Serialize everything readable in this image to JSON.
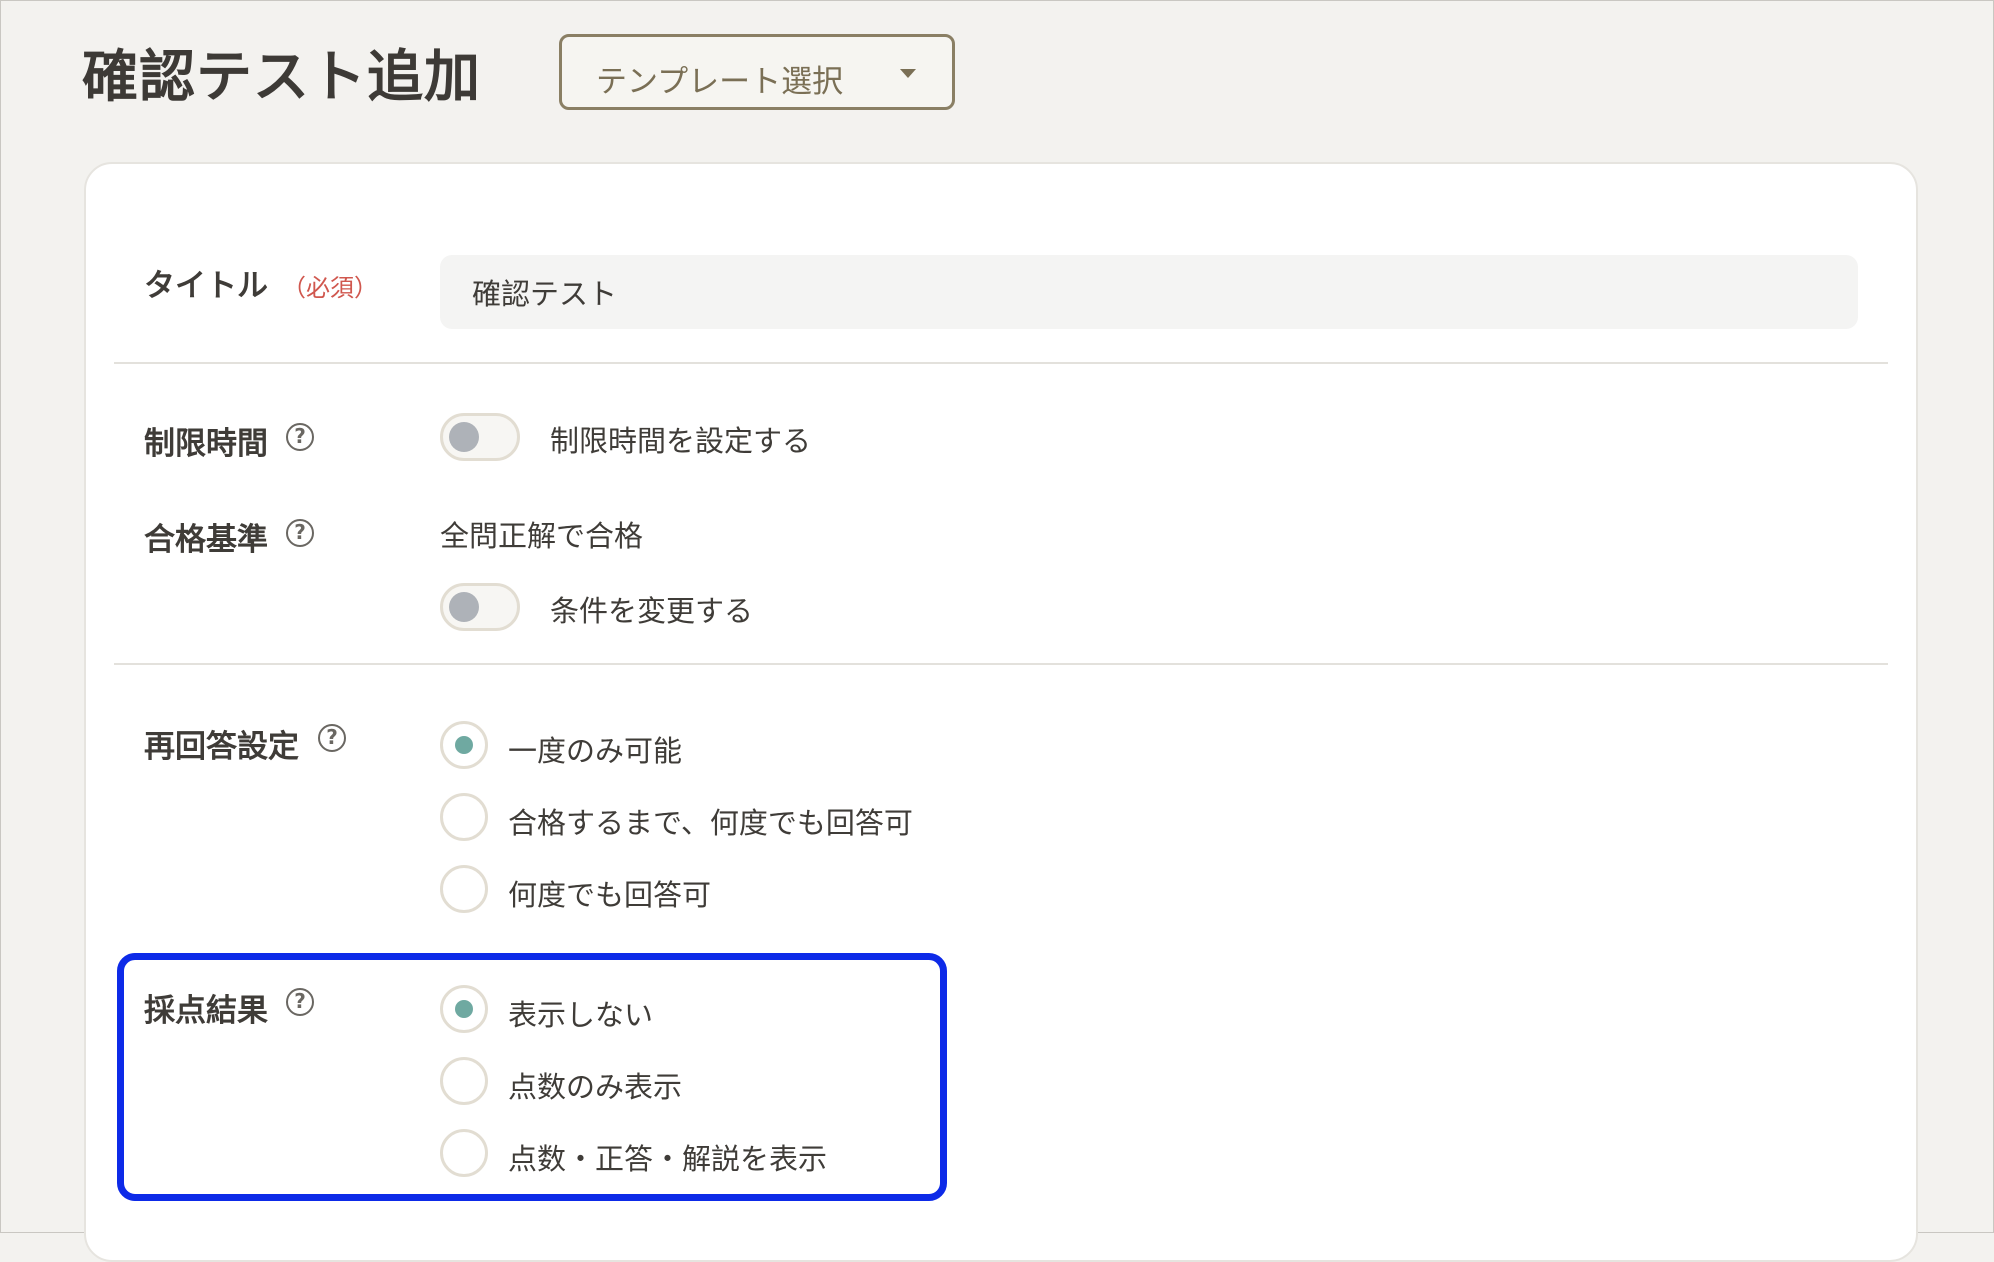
{
  "header": {
    "title": "確認テスト追加",
    "template_select": "テンプレート選択"
  },
  "form": {
    "title_row": {
      "label": "タイトル",
      "required": "（必須）",
      "value": "確認テスト"
    },
    "time_limit": {
      "label": "制限時間",
      "help": "?",
      "toggle_label": "制限時間を設定する",
      "enabled": false
    },
    "pass_criteria": {
      "label": "合格基準",
      "help": "?",
      "value": "全問正解で合格",
      "toggle_label": "条件を変更する",
      "enabled": false
    },
    "reanswer": {
      "label": "再回答設定",
      "help": "?",
      "options": [
        "一度のみ可能",
        "合格するまで、何度でも回答可",
        "何度でも回答可"
      ],
      "selected_index": 0
    },
    "scoring": {
      "label": "採点結果",
      "help": "?",
      "options": [
        "表示しない",
        "点数のみ表示",
        "点数・正答・解説を表示"
      ],
      "selected_index": 0
    }
  },
  "colors": {
    "accent_radio": "#6fa9a1",
    "required": "#d0574e",
    "highlight": "#0d2ae8",
    "select_border": "#8a7f64"
  }
}
